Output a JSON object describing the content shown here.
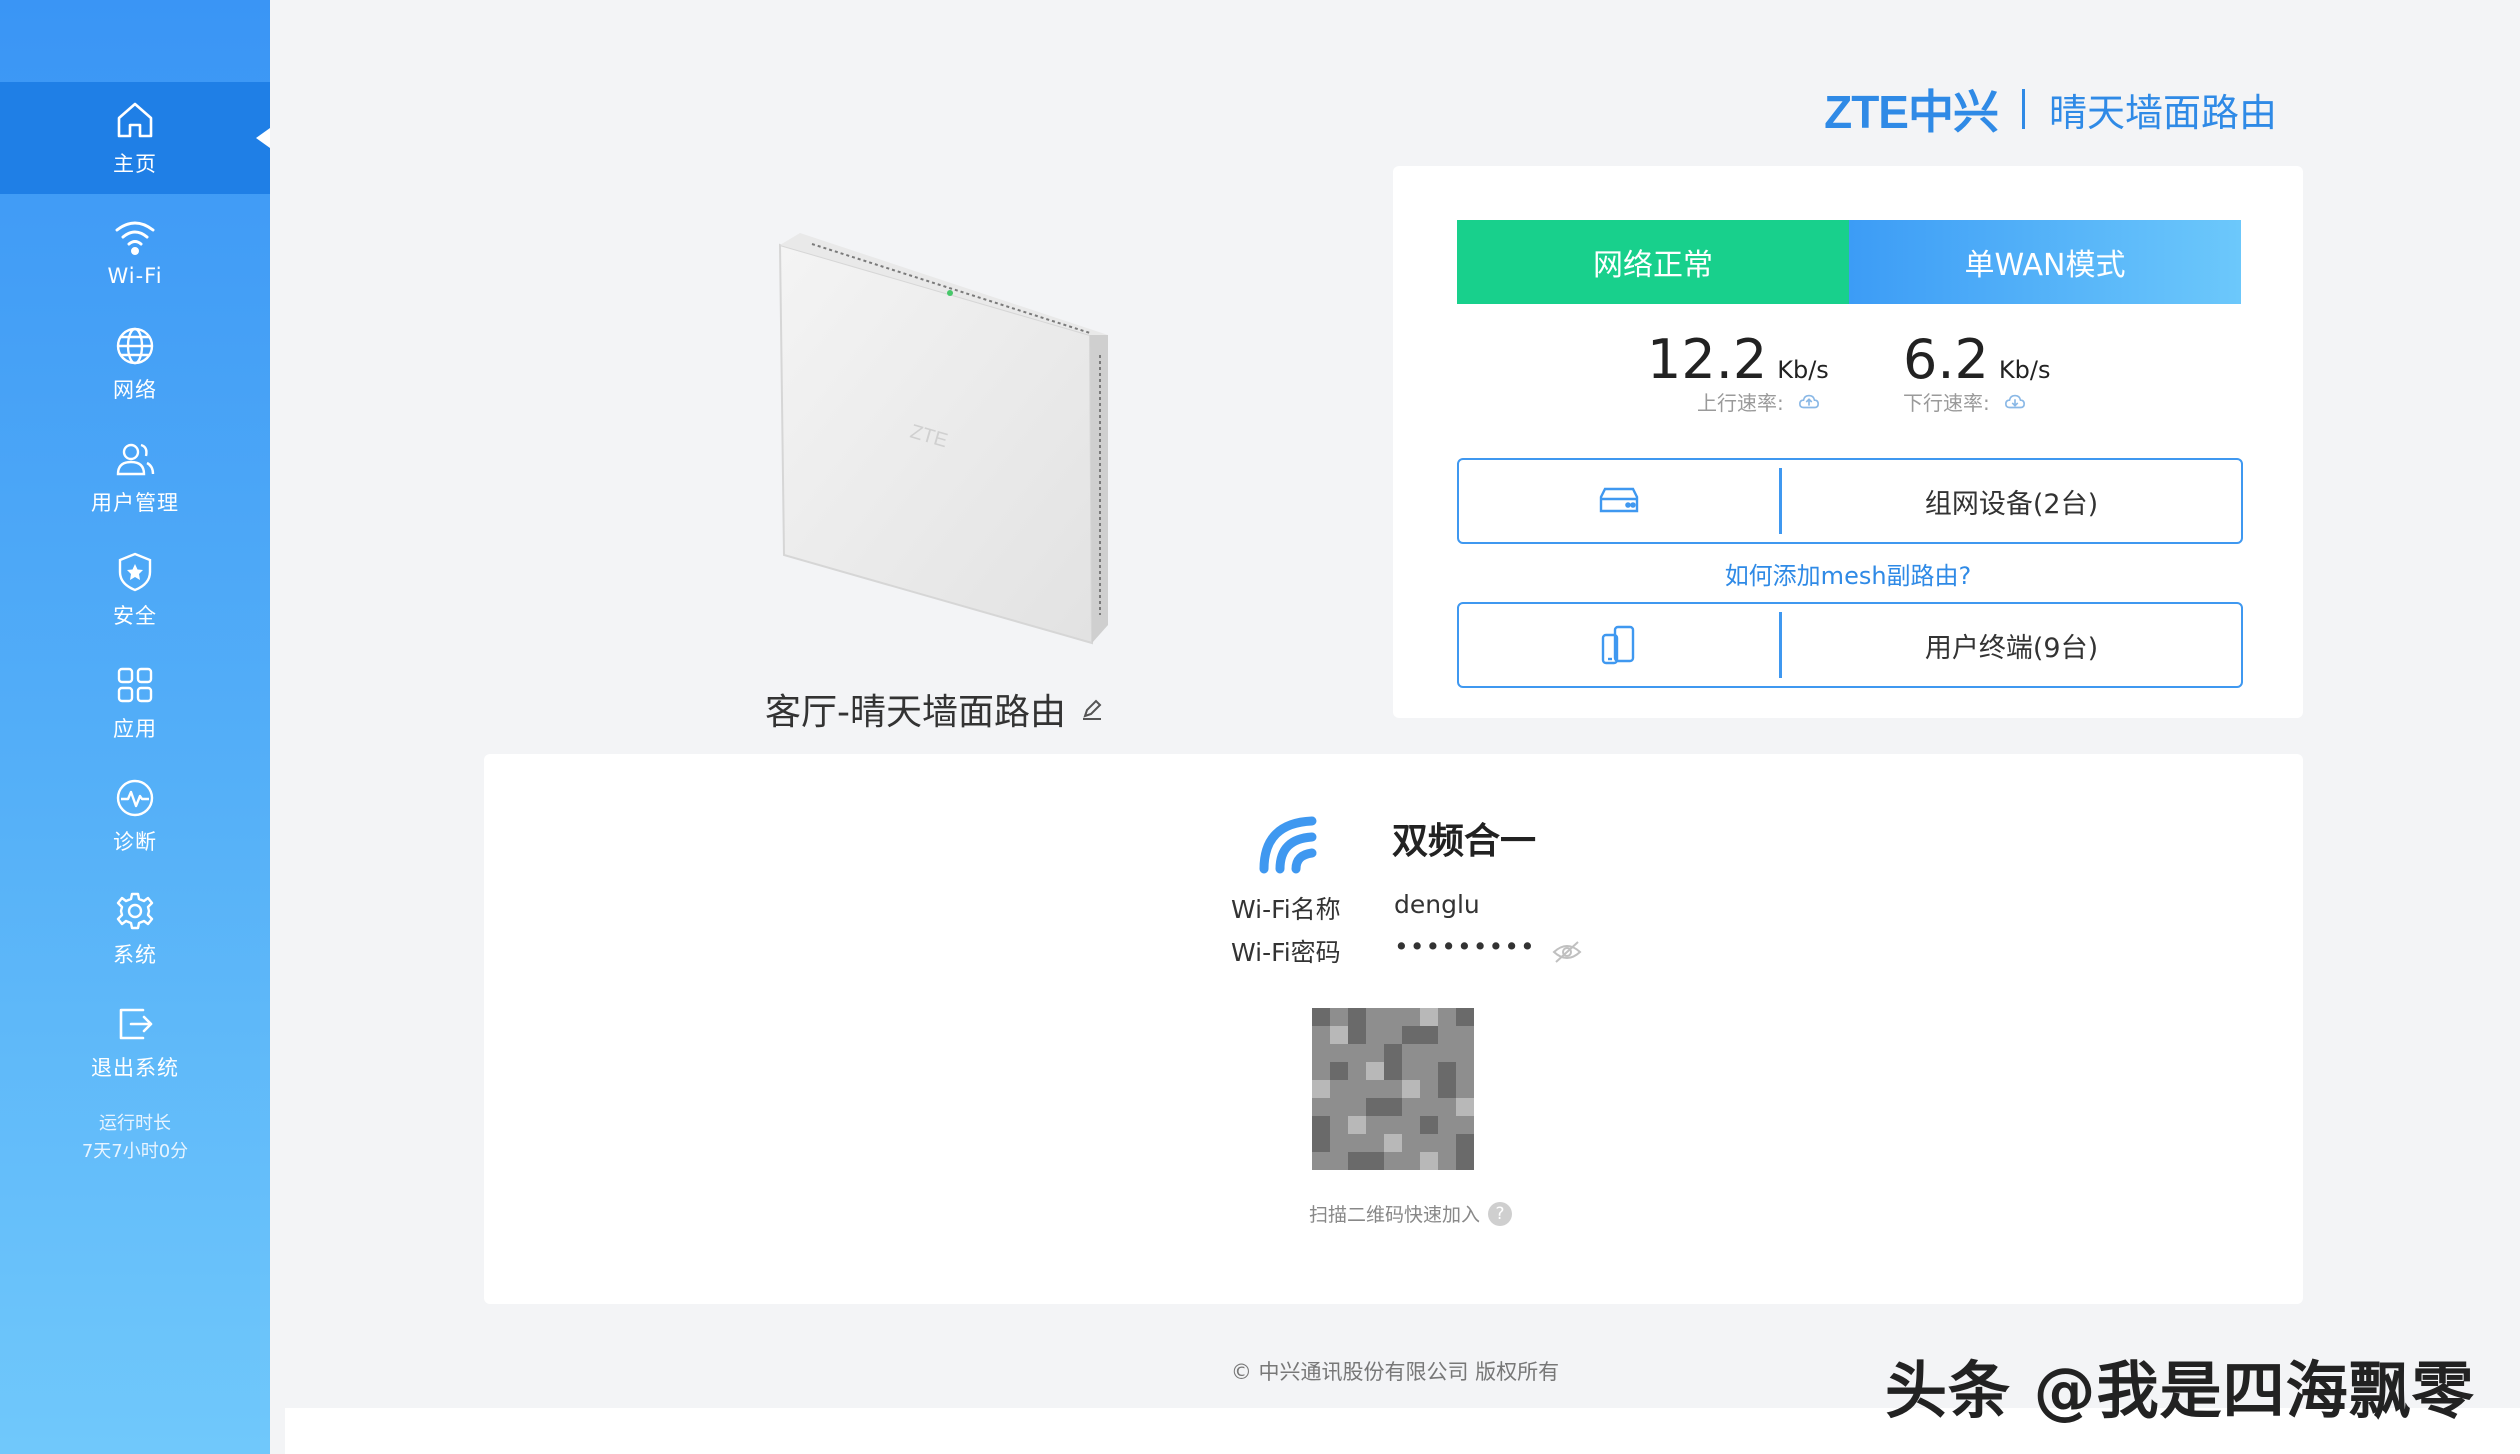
{
  "sidebar": {
    "items": [
      {
        "label": "主页",
        "icon": "home-icon"
      },
      {
        "label": "Wi-Fi",
        "icon": "wifi-icon"
      },
      {
        "label": "网络",
        "icon": "globe-icon"
      },
      {
        "label": "用户管理",
        "icon": "users-icon"
      },
      {
        "label": "安全",
        "icon": "shield-icon"
      },
      {
        "label": "应用",
        "icon": "apps-icon"
      },
      {
        "label": "诊断",
        "icon": "pulse-icon"
      },
      {
        "label": "系统",
        "icon": "gear-icon"
      },
      {
        "label": "退出系统",
        "icon": "logout-icon"
      }
    ],
    "uptime_label": "运行时长",
    "uptime_value": "7天7小时0分"
  },
  "header": {
    "logo": "ZTE中兴",
    "title": "晴天墙面路由"
  },
  "router": {
    "name": "客厅-晴天墙面路由",
    "device_label": "ZTE"
  },
  "status": {
    "network": "网络正常",
    "mode": "单WAN模式",
    "upload": {
      "value": "12.2",
      "unit": "Kb/s",
      "label": "上行速率:"
    },
    "download": {
      "value": "6.2",
      "unit": "Kb/s",
      "label": "下行速率:"
    },
    "mesh_devices": "组网设备(2台)",
    "mesh_link": "如何添加mesh副路由?",
    "clients": "用户终端(9台)"
  },
  "wifi": {
    "title": "双频合一",
    "name_label": "Wi-Fi名称",
    "name_value": "denglu",
    "password_label": "Wi-Fi密码",
    "password_value": "•••••••••",
    "qr_caption": "扫描二维码快速加入",
    "help": "?"
  },
  "footer": "© 中兴通讯股份有限公司 版权所有",
  "watermark": "头条 @我是四海飘零",
  "colors": {
    "accent": "#2f8ae6",
    "ok": "#18d08c",
    "sidebar_active": "#1f7fe6"
  }
}
